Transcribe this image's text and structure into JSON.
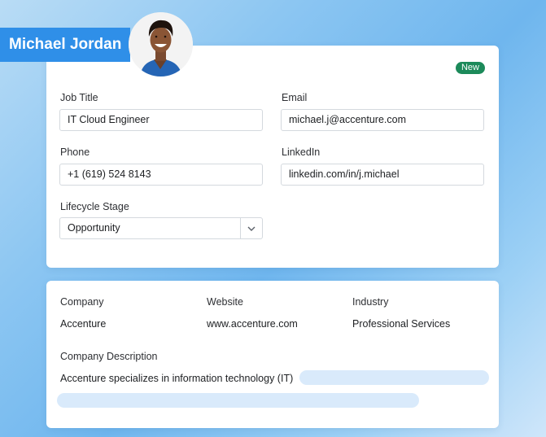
{
  "profile": {
    "name": "Michael Jordan"
  },
  "badge": {
    "label": "New",
    "color": "#1c8a5a"
  },
  "contact": {
    "job_title_label": "Job Title",
    "job_title_value": "IT Cloud Engineer",
    "email_label": "Email",
    "email_value": "michael.j@accenture.com",
    "phone_label": "Phone",
    "phone_value": "+1 (619) 524 8143",
    "linkedin_label": "LinkedIn",
    "linkedin_value": "linkedin.com/in/j.michael",
    "lifecycle_label": "Lifecycle Stage",
    "lifecycle_value": "Opportunity"
  },
  "company": {
    "company_label": "Company",
    "company_value": "Accenture",
    "website_label": "Website",
    "website_value": "www.accenture.com",
    "industry_label": "Industry",
    "industry_value": "Professional Services",
    "description_label": "Company Description",
    "description_value": "Accenture specializes in information technology (IT)"
  },
  "colors": {
    "banner": "#2f8fe8",
    "skeleton": "#d9eafb"
  },
  "icons": {
    "avatar": "person-photo",
    "select": "chevron-down-icon"
  }
}
